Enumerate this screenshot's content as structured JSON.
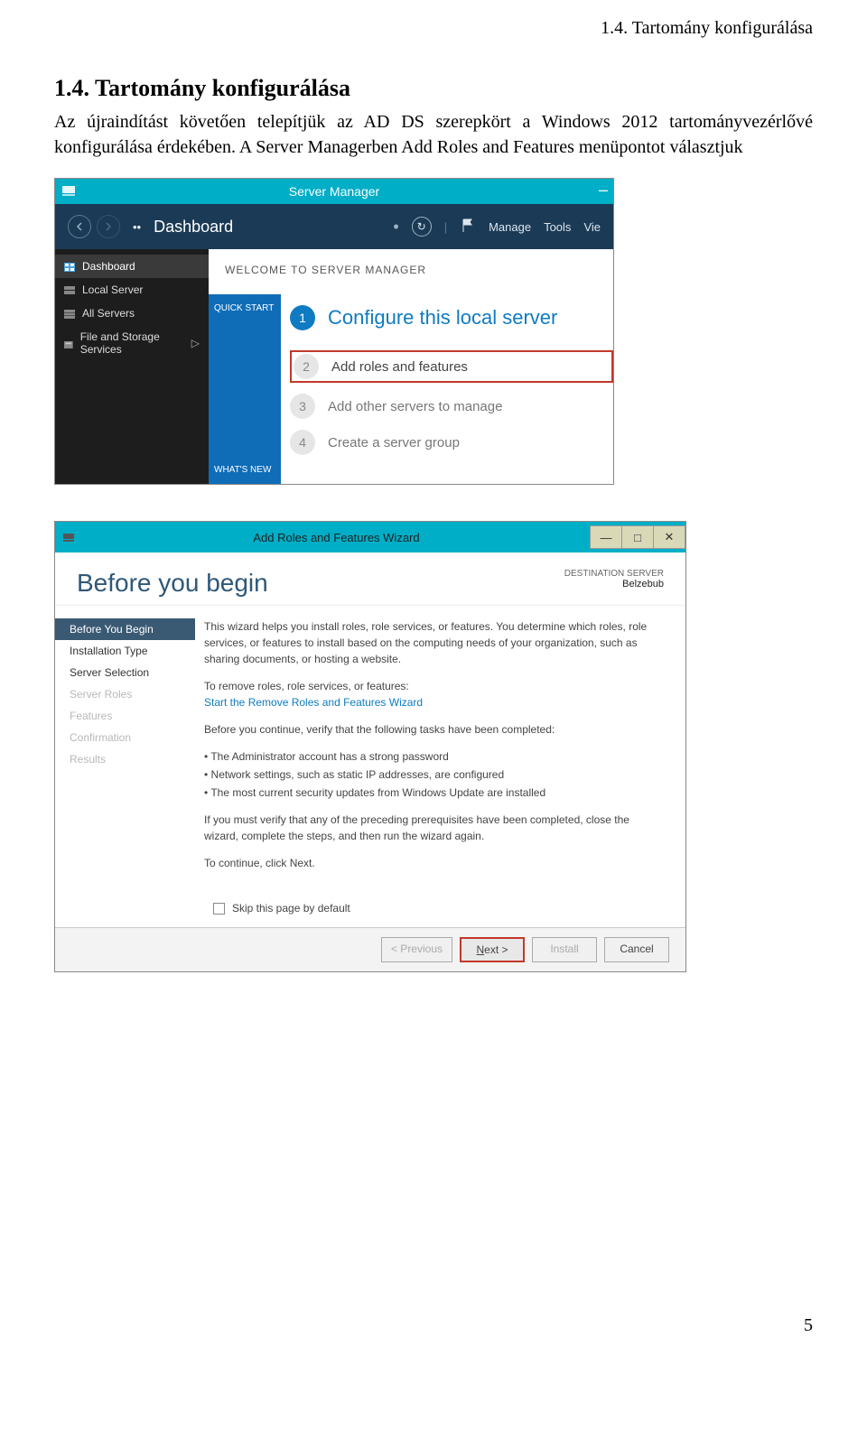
{
  "doc": {
    "header": "1.4. Tartomány konfigurálása",
    "section_title": "1.4. Tartomány konfigurálása",
    "paragraph": "Az újraindítást követően telepítjük az AD DS szerepkört a Windows 2012 tartományvezérlővé konfigurálása érdekében. A Server Managerben Add Roles and Features menüpontot választjuk",
    "page_number": "5"
  },
  "sm": {
    "window_title": "Server Manager",
    "dashboard_label": "Dashboard",
    "menu": {
      "manage": "Manage",
      "tools": "Tools",
      "view": "Vie"
    },
    "sidebar": [
      {
        "label": "Dashboard",
        "active": true
      },
      {
        "label": "Local Server",
        "active": false
      },
      {
        "label": "All Servers",
        "active": false
      },
      {
        "label": "File and Storage Services",
        "active": false,
        "chevron": "▷"
      }
    ],
    "welcome": "WELCOME TO SERVER MANAGER",
    "leftband": {
      "top": "QUICK START",
      "bottom": "WHAT'S NEW"
    },
    "config_title": "Configure this local server",
    "steps": [
      {
        "num": "2",
        "label": "Add roles and features",
        "highlight": true
      },
      {
        "num": "3",
        "label": "Add other servers to manage",
        "highlight": false
      },
      {
        "num": "4",
        "label": "Create a server group",
        "highlight": false
      }
    ]
  },
  "wiz": {
    "window_title": "Add Roles and Features Wizard",
    "heading": "Before you begin",
    "destination_label": "DESTINATION SERVER",
    "destination_server": "Belzebub",
    "nav": [
      {
        "label": "Before You Begin",
        "state": "active"
      },
      {
        "label": "Installation Type",
        "state": "normal"
      },
      {
        "label": "Server Selection",
        "state": "normal"
      },
      {
        "label": "Server Roles",
        "state": "disabled"
      },
      {
        "label": "Features",
        "state": "disabled"
      },
      {
        "label": "Confirmation",
        "state": "disabled"
      },
      {
        "label": "Results",
        "state": "disabled"
      }
    ],
    "p1": "This wizard helps you install roles, role services, or features. You determine which roles, role services, or features to install based on the computing needs of your organization, such as sharing documents, or hosting a website.",
    "p2a": "To remove roles, role services, or features:",
    "p2b": "Start the Remove Roles and Features Wizard",
    "p3": "Before you continue, verify that the following tasks have been completed:",
    "bullets": [
      "The Administrator account has a strong password",
      "Network settings, such as static IP addresses, are configured",
      "The most current security updates from Windows Update are installed"
    ],
    "p4": "If you must verify that any of the preceding prerequisites have been completed, close the wizard, complete the steps, and then run the wizard again.",
    "p5": "To continue, click Next.",
    "skip_label": "Skip this page by default",
    "buttons": {
      "previous": "< Previous",
      "next": "Next >",
      "install": "Install",
      "cancel": "Cancel"
    }
  }
}
